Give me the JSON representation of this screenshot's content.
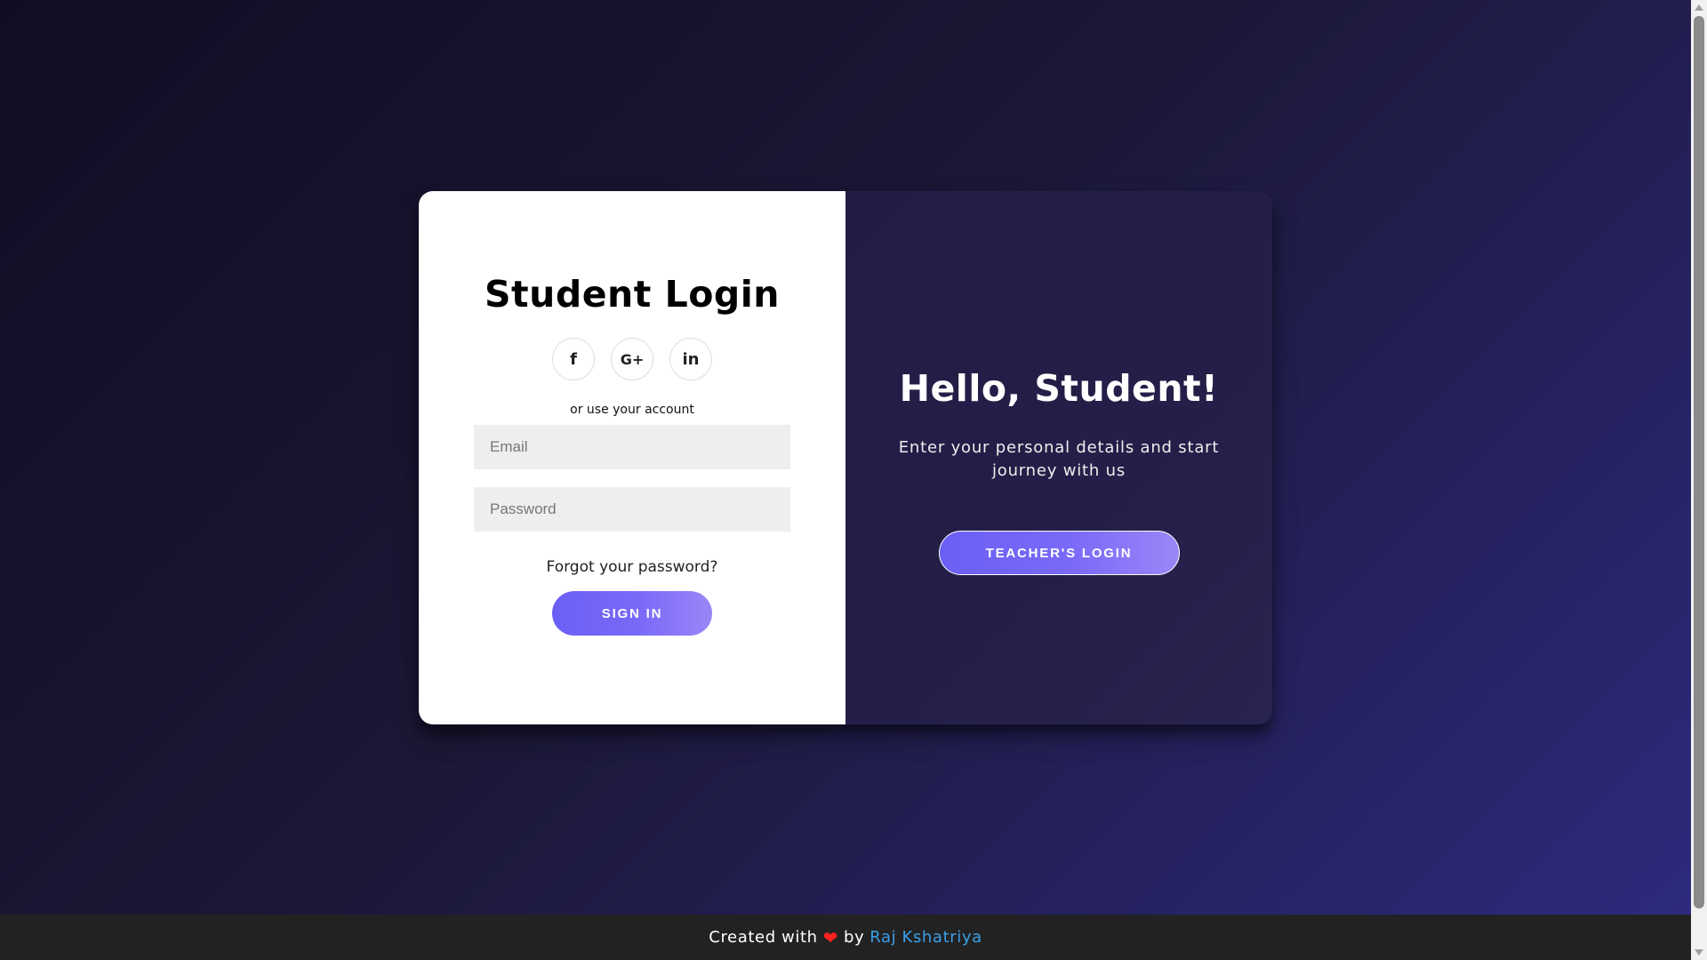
{
  "login": {
    "title": "Student Login",
    "social": [
      {
        "icon": "facebook-icon",
        "glyph": "f"
      },
      {
        "icon": "google-plus-icon",
        "glyph": "G+"
      },
      {
        "icon": "linkedin-icon",
        "glyph": "in"
      }
    ],
    "subtext": "or use your account",
    "email_placeholder": "Email",
    "email_value": "",
    "password_placeholder": "Password",
    "password_value": "",
    "forgot_label": "Forgot your password?",
    "signin_label": "SIGN IN"
  },
  "overlay": {
    "title": "Hello, Student!",
    "text": "Enter your personal details and start journey with us",
    "teacher_label": "TEACHER'S LOGIN"
  },
  "footer": {
    "prefix": "Created with",
    "heart": "❤",
    "by": "by",
    "author": "Raj Kshatriya"
  },
  "colors": {
    "accent_start": "#6a5ff5",
    "accent_end": "#9b86f7",
    "background_dark": "#110d24",
    "overlay_panel": "#221d45",
    "footer_bg": "#222222",
    "link": "#3aa0e8",
    "heart": "#ff2020"
  }
}
